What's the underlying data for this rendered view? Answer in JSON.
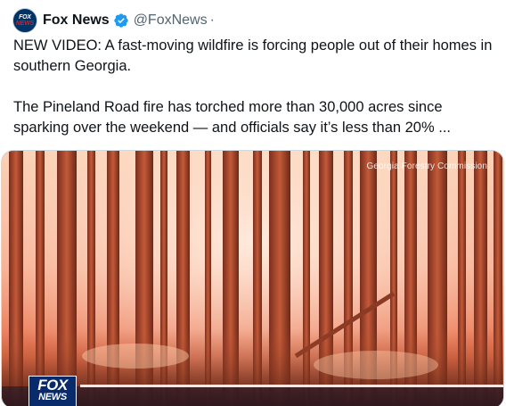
{
  "tweet": {
    "avatar_text_1": "FOX",
    "avatar_text_2": "NEWS",
    "display_name": "Fox News",
    "handle": "@FoxNews",
    "separator": "·",
    "paragraph_1": "NEW VIDEO: A fast-moving wildfire is forcing people out of their homes in southern Georgia.",
    "paragraph_2": "The Pineland Road fire has torched more than 30,000 acres since sparking over the weekend — and officials say it’s less than 20% ..."
  },
  "media": {
    "credit": "Georgia Forestry Commission",
    "logo_line_1": "FOX",
    "logo_line_2": "NEWS"
  },
  "colors": {
    "verified_badge": "#1d9bf0",
    "fire_sky": "#f9c3a0",
    "tree_trunk": "#c85a3a"
  }
}
